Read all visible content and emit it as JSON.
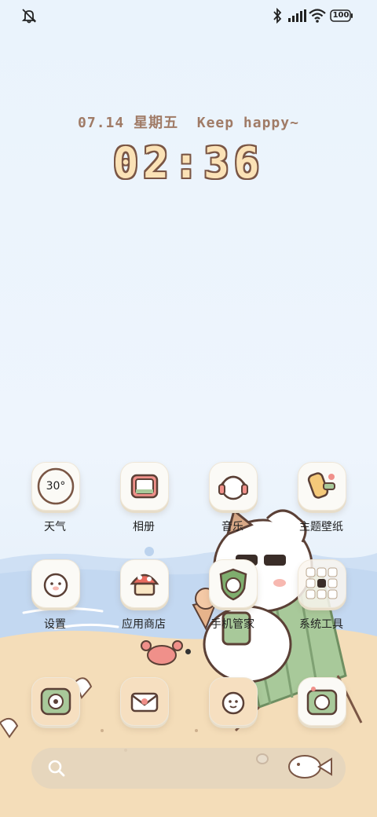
{
  "status_bar": {
    "left_icons": [
      "mute-icon"
    ],
    "right_icons": [
      "bluetooth-icon",
      "signal-icon",
      "wifi-icon",
      "battery-icon"
    ],
    "battery_level": "100"
  },
  "lockclock": {
    "date": "07.14 星期五  Keep happy~",
    "time": "02:36"
  },
  "apps": [
    {
      "label": "天气",
      "icon": "weather-icon",
      "value": "30°"
    },
    {
      "label": "相册",
      "icon": "gallery-icon"
    },
    {
      "label": "音乐",
      "icon": "music-icon"
    },
    {
      "label": "主题壁纸",
      "icon": "themes-icon"
    },
    {
      "label": "设置",
      "icon": "settings-icon"
    },
    {
      "label": "应用商店",
      "icon": "app-store-icon"
    },
    {
      "label": "手机管家",
      "icon": "security-icon"
    },
    {
      "label": "系统工具",
      "icon": "system-tools-folder-icon"
    }
  ],
  "dock": [
    {
      "icon": "phone-icon"
    },
    {
      "icon": "messages-icon"
    },
    {
      "icon": "contacts-icon"
    },
    {
      "icon": "camera-icon"
    }
  ],
  "page_indicator": {
    "pages": 1,
    "current": 1
  },
  "search": {
    "icon": "search-icon"
  },
  "colors": {
    "sky": "#eaf3fc",
    "sea": "#c7dbf2",
    "sand": "#f3dcb8",
    "clock_fill": "#fbe2b6",
    "clock_outline": "#7a5645",
    "date_text": "#a07b66"
  }
}
